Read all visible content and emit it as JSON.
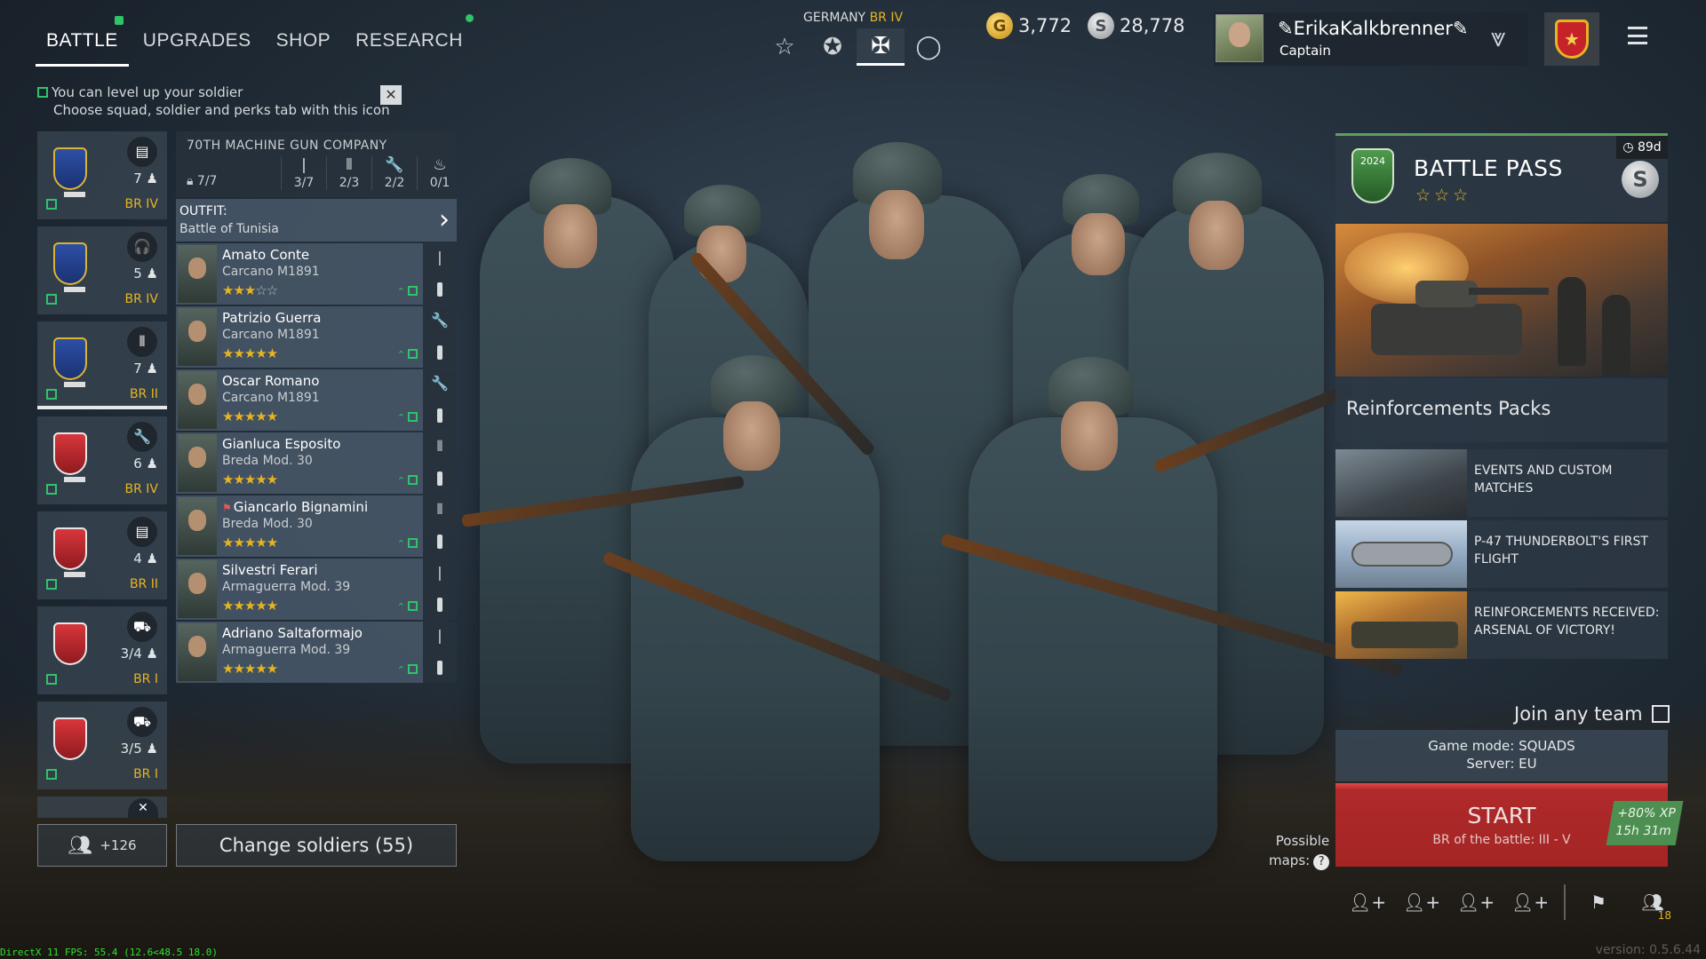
{
  "top_nav": {
    "tabs": [
      {
        "label": "BATTLE",
        "active": true
      },
      {
        "label": "UPGRADES",
        "active": false
      },
      {
        "label": "SHOP",
        "active": false
      },
      {
        "label": "RESEARCH",
        "active": false
      }
    ]
  },
  "hint": {
    "line1": "You can level up your soldier",
    "line2": "Choose squad, soldier and perks tab with this icon",
    "close": "✕"
  },
  "nation": {
    "name": "GERMANY",
    "br": "BR IV"
  },
  "modes": [
    {
      "icon": "star-outline-icon",
      "glyph": "☆"
    },
    {
      "icon": "star-badge-icon",
      "glyph": "✪"
    },
    {
      "icon": "iron-cross-icon",
      "glyph": "✠"
    },
    {
      "icon": "circle-icon",
      "glyph": "◯"
    }
  ],
  "currency": {
    "gold": "3,772",
    "silver": "28,778",
    "gold_glyph": "G",
    "silver_glyph": "S"
  },
  "player": {
    "name": "ErikaKalkbrenner",
    "rank": "Captain"
  },
  "squads": [
    {
      "type_glyph": "▤",
      "count": "7",
      "br": "BR IV",
      "color": "blue",
      "active": false
    },
    {
      "type_glyph": "🎧",
      "count": "5",
      "br": "BR IV",
      "color": "blue",
      "active": false
    },
    {
      "type_glyph": "⫴",
      "count": "7",
      "br": "BR II",
      "color": "blue",
      "active": true
    },
    {
      "type_glyph": "🔧",
      "count": "6",
      "br": "BR IV",
      "color": "red",
      "active": false
    },
    {
      "type_glyph": "▤",
      "count": "4",
      "br": "BR II",
      "color": "red",
      "active": false
    },
    {
      "type_glyph": "⛟",
      "count": "3/4",
      "br": "BR I",
      "color": "red",
      "active": false
    },
    {
      "type_glyph": "⛟",
      "count": "3/5",
      "br": "BR I",
      "color": "red",
      "active": false
    }
  ],
  "squad_panel": {
    "name": "70TH MACHINE GUN COMPANY",
    "count": "7/7",
    "stats": [
      "3/7",
      "2/3",
      "2/2",
      "0/1"
    ],
    "outfit_label": "OUTFIT:",
    "outfit_value": "Battle of Tunisia"
  },
  "soldiers": [
    {
      "name": "Amato Conte",
      "weapon": "Carcano M1891",
      "stars": 3,
      "class_glyph": "|"
    },
    {
      "name": "Patrizio Guerra",
      "weapon": "Carcano M1891",
      "stars": 5,
      "class_glyph": "🔧"
    },
    {
      "name": "Oscar Romano",
      "weapon": "Carcano M1891",
      "stars": 5,
      "class_glyph": "🔧"
    },
    {
      "name": "Gianluca Esposito",
      "weapon": "Breda Mod. 30",
      "stars": 5,
      "class_glyph": "⫴"
    },
    {
      "name": "Giancarlo Bignamini",
      "weapon": "Breda Mod. 30",
      "stars": 5,
      "class_glyph": "⫴"
    },
    {
      "name": "Silvestri Ferari",
      "weapon": "Armaguerra Mod. 39",
      "stars": 5,
      "class_glyph": "|"
    },
    {
      "name": "Adriano Saltaformajo",
      "weapon": "Armaguerra Mod. 39",
      "stars": 5,
      "class_glyph": "|"
    }
  ],
  "reserve": {
    "count": "+126"
  },
  "change_soldiers": "Change soldiers (55)",
  "battle_pass": {
    "title": "BATTLE PASS",
    "timer": "89d",
    "logo_text": "2024"
  },
  "reinforcements": {
    "title": "Reinforcements Packs"
  },
  "events": [
    {
      "title": "EVENTS AND CUSTOM MATCHES"
    },
    {
      "title": "P-47 THUNDERBOLT'S FIRST FLIGHT"
    },
    {
      "title": "REINFORCEMENTS RECEIVED: ARSENAL OF VICTORY!"
    }
  ],
  "join_any_team": "Join any team",
  "game_mode": {
    "mode": "Game mode: SQUADS",
    "server": "Server: EU"
  },
  "start": {
    "label": "START",
    "sub": "BR of the battle: III - V",
    "xp": "+80% XP",
    "time": "15h 31m"
  },
  "possible_maps": {
    "line1": "Possible",
    "line2": "maps:",
    "q": "?"
  },
  "invite_count": "18",
  "fps": "DirectX 11 FPS: 55.4 (12.6<48.5 18.0)",
  "version": "version: 0.5.6.44",
  "colors": {
    "accent_gold": "#e6b422",
    "level_green": "#2fc36a",
    "start_red": "#b02a2a"
  }
}
